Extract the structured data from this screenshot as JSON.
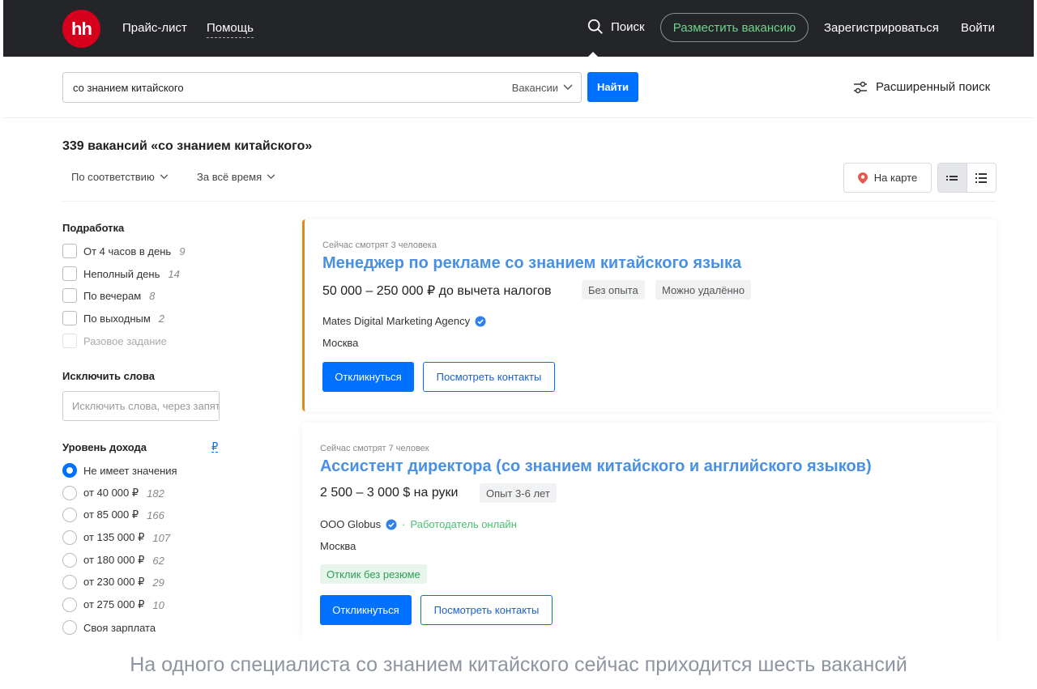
{
  "header": {
    "logo_text": "hh",
    "nav": [
      "Прайс-лист",
      "Помощь"
    ],
    "search_label": "Поиск",
    "post_vacancy": "Разместить вакансию",
    "register": "Зарегистрироваться",
    "login": "Войти"
  },
  "search": {
    "query": "со знанием китайского",
    "type": "Вакансии",
    "find": "Найти",
    "advanced": "Расширенный поиск"
  },
  "results": {
    "title": "339 вакансий «со знанием китайского»",
    "sort": "По соответствию",
    "period": "За всё время",
    "map": "На карте"
  },
  "sidebar": {
    "parttime_heading": "Подработка",
    "parttime": [
      {
        "label": "От 4 часов в день",
        "count": "9"
      },
      {
        "label": "Неполный день",
        "count": "14"
      },
      {
        "label": "По вечерам",
        "count": "8"
      },
      {
        "label": "По выходным",
        "count": "2"
      },
      {
        "label": "Разовое задание",
        "count": ""
      }
    ],
    "exclude_heading": "Исключить слова",
    "exclude_placeholder": "Исключить слова, через запятую",
    "income_heading": "Уровень дохода",
    "currency": "₽",
    "income": [
      {
        "label": "Не имеет значения",
        "count": ""
      },
      {
        "label": "от 40 000 ₽",
        "count": "182"
      },
      {
        "label": "от 85 000 ₽",
        "count": "166"
      },
      {
        "label": "от 135 000 ₽",
        "count": "107"
      },
      {
        "label": "от 180 000 ₽",
        "count": "62"
      },
      {
        "label": "от 230 000 ₽",
        "count": "29"
      },
      {
        "label": "от 275 000 ₽",
        "count": "10"
      },
      {
        "label": "Своя зарплата",
        "count": ""
      }
    ]
  },
  "vacancies": [
    {
      "watching": "Сейчас смотрят 3 человека",
      "title": "Менеджер по рекламе со знанием китайского языка",
      "salary": "50 000 – 250 000 ₽ до вычета налогов",
      "tags": [
        "Без опыта",
        "Можно удалённо"
      ],
      "company": "Mates Digital Marketing Agency",
      "city": "Москва",
      "apply": "Откликнуться",
      "contacts": "Посмотреть контакты"
    },
    {
      "watching": "Сейчас смотрят 7 человек",
      "title": "Ассистент директора (со знанием китайского и английского языков)",
      "salary": "2 500 – 3 000 $ на руки",
      "tags": [
        "Опыт 3-6 лет"
      ],
      "company": "ООО Globus",
      "online": "Работодатель онлайн",
      "city": "Москва",
      "no_resume": "Отклик без резюме",
      "apply": "Откликнуться",
      "contacts": "Посмотреть контакты"
    }
  ],
  "caption": "На одного специалиста со знанием китайского сейчас приходится шесть вакансий",
  "colors": {
    "header_bg": "#232529",
    "brand_red": "#d6001c",
    "accent_blue": "#0070ff",
    "title_blue": "#4a90e2",
    "green": "#4bbf73",
    "card_accent": "#e08a1e"
  }
}
